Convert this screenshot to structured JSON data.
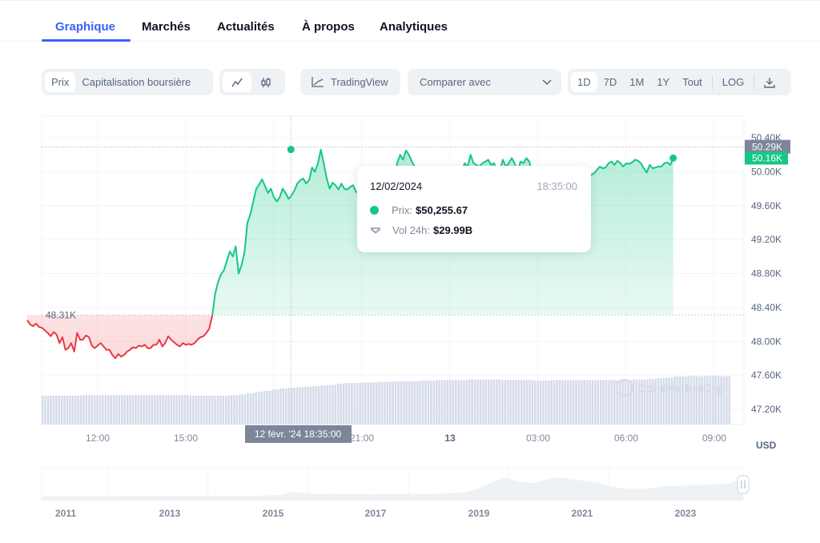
{
  "tabs": [
    {
      "label": "Graphique",
      "active": true
    },
    {
      "label": "Marchés",
      "active": false
    },
    {
      "label": "Actualités",
      "active": false
    },
    {
      "label": "À propos",
      "active": false
    },
    {
      "label": "Analytiques",
      "active": false
    }
  ],
  "toolbar": {
    "metric_toggle": {
      "options": [
        "Prix",
        "Capitalisation boursière"
      ],
      "selected": "Prix"
    },
    "chart_type": {
      "options": [
        "line-chart-icon",
        "candlestick-icon"
      ],
      "selected": "line-chart-icon"
    },
    "tradingview_label": "TradingView",
    "compare_label": "Comparer avec",
    "ranges": [
      "1D",
      "7D",
      "1M",
      "1Y",
      "Tout"
    ],
    "range_selected": "1D",
    "log_label": "LOG",
    "download_icon": "download-icon"
  },
  "tooltip": {
    "date": "12/02/2024",
    "time": "18:35:00",
    "price_label": "Prix:",
    "price_value": "$50,255.67",
    "volume_label": "Vol 24h:",
    "volume_value": "$29.99B"
  },
  "colors": {
    "up": "#16c784",
    "down": "#ea3943",
    "accent": "#3861fb",
    "volume": "#d5dbea",
    "crosshair_label_bg": "#7d8699"
  },
  "chart_data": {
    "type": "line",
    "title": "",
    "currency_label": "USD",
    "ylim": [
      47000,
      50450
    ],
    "y_ticks": [
      47200,
      47600,
      48000,
      48400,
      48800,
      49200,
      49600,
      50000,
      50400
    ],
    "y_tick_labels": [
      "47.20K",
      "47.60K",
      "48.00K",
      "48.40K",
      "48.80K",
      "49.20K",
      "49.60K",
      "50.00K",
      "50.40K"
    ],
    "x_ticks": [
      "12:00",
      "15:00",
      "18:00",
      "21:00",
      "13",
      "03:00",
      "06:00",
      "09:00"
    ],
    "x_tick_hours": [
      12,
      15,
      18,
      21,
      24,
      27,
      30,
      33
    ],
    "xlim_hours": [
      9.6,
      33.9
    ],
    "baseline": 48310,
    "baseline_label": "48.31K",
    "crosshair": {
      "hour": 18.58,
      "price": 50290,
      "x_label": "12 févr. '24   18:35:00",
      "y_label": "50.29K"
    },
    "last_price_label": "50.16K",
    "last_price": 50160,
    "price_series_hours_step": 0.1,
    "price_series": [
      48250,
      48200,
      48180,
      48210,
      48170,
      48160,
      48130,
      48100,
      48060,
      48110,
      48080,
      47980,
      48050,
      47900,
      47920,
      47980,
      47880,
      48100,
      48020,
      48020,
      48070,
      48050,
      47950,
      47920,
      47950,
      47980,
      47940,
      47900,
      47900,
      47840,
      47800,
      47850,
      47820,
      47840,
      47880,
      47900,
      47930,
      47920,
      47950,
      47940,
      47960,
      47920,
      47920,
      47960,
      47960,
      48020,
      47940,
      47980,
      48060,
      48020,
      47990,
      47960,
      47940,
      47980,
      47960,
      47970,
      47960,
      47980,
      48020,
      48050,
      48060,
      48100,
      48150,
      48300,
      48560,
      48700,
      48790,
      48840,
      48950,
      49060,
      49000,
      49120,
      48800,
      48900,
      49050,
      49400,
      49500,
      49650,
      49800,
      49850,
      49910,
      49830,
      49750,
      49800,
      49700,
      49650,
      49700,
      49800,
      49750,
      49680,
      49720,
      49780,
      49860,
      49900,
      49920,
      49860,
      49900,
      50050,
      50000,
      50100,
      50260,
      50100,
      49920,
      49800,
      49870,
      49840,
      49790,
      49860,
      49800,
      49790,
      49820,
      49840,
      49760,
      49760,
      49720,
      49790,
      49720,
      49730,
      49700,
      49820,
      49900,
      49880,
      49780,
      49760,
      49900,
      49950,
      50100,
      50200,
      50140,
      50250,
      50200,
      50120,
      50060,
      49980,
      49900,
      49880,
      49940,
      49960,
      49900,
      49880,
      49940,
      49920,
      49860,
      49940,
      49960,
      49880,
      49900,
      49880,
      50000,
      50100,
      50060,
      50200,
      50100,
      50080,
      50060,
      50100,
      50120,
      50140,
      50080,
      50100,
      50000,
      50020,
      50140,
      50060,
      50100,
      50160,
      50100,
      50000,
      50120,
      50100,
      50160,
      50120,
      49960,
      49950,
      49940,
      49920,
      49880,
      49920,
      49860,
      49860,
      49880,
      49900,
      49880,
      49920,
      49940,
      49950,
      49940,
      49920,
      49960,
      49950,
      49990,
      50000,
      49960,
      49980,
      50020,
      50060,
      50040,
      50050,
      50100,
      50120,
      50080,
      50130,
      50100,
      50060,
      50100,
      50090,
      50110,
      50140,
      50130,
      50100,
      50040,
      49990,
      50080,
      50040,
      50050,
      50060,
      50060,
      50100,
      50110,
      50080,
      50160
    ],
    "volume_series_desc": "24h volume bars, relative height 0-1",
    "volume_series": [
      0.4,
      0.4,
      0.4,
      0.4,
      0.4,
      0.41,
      0.41,
      0.41,
      0.41,
      0.41,
      0.41,
      0.41,
      0.41,
      0.41,
      0.41,
      0.41,
      0.41,
      0.41,
      0.4,
      0.4,
      0.4,
      0.4,
      0.4,
      0.41,
      0.42,
      0.44,
      0.46,
      0.48,
      0.5,
      0.52,
      0.53,
      0.54,
      0.55,
      0.56,
      0.57,
      0.58,
      0.6,
      0.61,
      0.61,
      0.62,
      0.62,
      0.63,
      0.63,
      0.64,
      0.64,
      0.64,
      0.65,
      0.65,
      0.66,
      0.66,
      0.66,
      0.66,
      0.67,
      0.67,
      0.67,
      0.67,
      0.66,
      0.66,
      0.66,
      0.66,
      0.65,
      0.65,
      0.66,
      0.66,
      0.66,
      0.66,
      0.66,
      0.66,
      0.66,
      0.66,
      0.65,
      0.66,
      0.67,
      0.67,
      0.68,
      0.69,
      0.7,
      0.72,
      0.72,
      0.73,
      0.72,
      0.73,
      0.73,
      0.72
    ],
    "navigator": {
      "x_labels": [
        "2011",
        "2013",
        "2015",
        "2017",
        "2019",
        "2021",
        "2023"
      ],
      "series_desc": "long-term price history, normalized 0-1",
      "series": [
        0.01,
        0.01,
        0.01,
        0.01,
        0.01,
        0.01,
        0.02,
        0.02,
        0.02,
        0.02,
        0.02,
        0.02,
        0.02,
        0.02,
        0.03,
        0.03,
        0.03,
        0.04,
        0.06,
        0.18,
        0.12,
        0.1,
        0.11,
        0.1,
        0.09,
        0.08,
        0.09,
        0.1,
        0.11,
        0.1,
        0.12,
        0.13,
        0.17,
        0.3,
        0.55,
        0.72,
        0.6,
        0.52,
        0.65,
        0.75,
        0.68,
        0.62,
        0.55,
        0.38,
        0.32,
        0.3,
        0.32,
        0.4,
        0.42,
        0.44,
        0.46,
        0.48,
        0.52,
        0.7
      ]
    },
    "watermark": "CoinMarketCap"
  }
}
